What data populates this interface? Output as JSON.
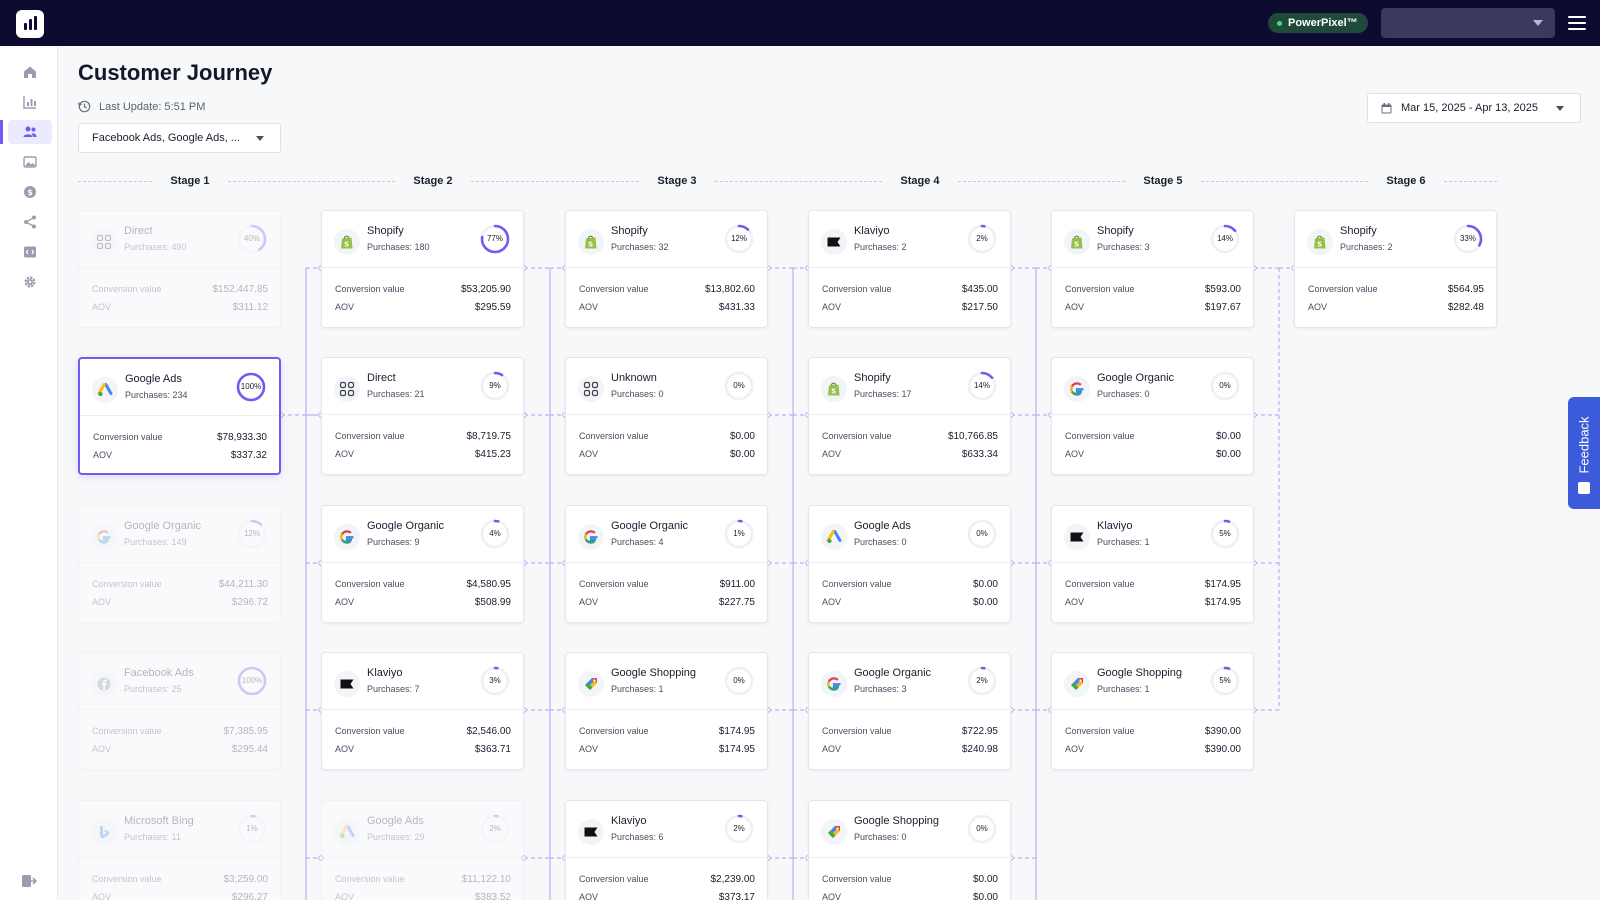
{
  "topbar": {
    "brand_badge": "PowerPixel™",
    "account_value": ""
  },
  "sidebar": {
    "items": [
      {
        "name": "home-icon",
        "active": false
      },
      {
        "name": "analytics-icon",
        "active": false
      },
      {
        "name": "customer-journey-icon",
        "active": true
      },
      {
        "name": "creatives-icon",
        "active": false
      },
      {
        "name": "revenue-icon",
        "active": false
      },
      {
        "name": "share-icon",
        "active": false
      },
      {
        "name": "code-icon",
        "active": false
      },
      {
        "name": "settings-icon",
        "active": false
      }
    ]
  },
  "header": {
    "title": "Customer Journey",
    "last_update": "Last Update: 5:51 PM",
    "source_filter": "Facebook Ads, Google Ads, ...",
    "date_range": "Mar 15, 2025 - Apr 13, 2025"
  },
  "labels": {
    "conversion_value": "Conversion value",
    "aov": "AOV"
  },
  "stages": [
    {
      "label": "Stage 1",
      "cards": [
        {
          "channel": "Direct",
          "icon": "direct-icon",
          "purchases": "Purchases: 490",
          "pct": 40,
          "pct_label": "40%",
          "conversion_value": "$152,447.85",
          "aov": "$311.12",
          "state": "dim"
        },
        {
          "channel": "Google Ads",
          "icon": "google-ads-icon",
          "purchases": "Purchases: 234",
          "pct": 100,
          "pct_label": "100%",
          "conversion_value": "$78,933.30",
          "aov": "$337.32",
          "state": "selected"
        },
        {
          "channel": "Google Organic",
          "icon": "google-icon",
          "purchases": "Purchases: 149",
          "pct": 12,
          "pct_label": "12%",
          "conversion_value": "$44,211.30",
          "aov": "$296.72",
          "state": "dim"
        },
        {
          "channel": "Facebook Ads",
          "icon": "facebook-icon",
          "purchases": "Purchases: 25",
          "pct": 100,
          "pct_label": "100%",
          "conversion_value": "$7,385.95",
          "aov": "$295.44",
          "state": "dim"
        },
        {
          "channel": "Microsoft Bing",
          "icon": "bing-icon",
          "purchases": "Purchases: 11",
          "pct": 1,
          "pct_label": "1%",
          "conversion_value": "$3,259.00",
          "aov": "$296.27",
          "state": "dim"
        }
      ]
    },
    {
      "label": "Stage 2",
      "cards": [
        {
          "channel": "Shopify",
          "icon": "shopify-icon",
          "purchases": "Purchases: 180",
          "pct": 77,
          "pct_label": "77%",
          "conversion_value": "$53,205.90",
          "aov": "$295.59",
          "state": "normal"
        },
        {
          "channel": "Direct",
          "icon": "direct-icon",
          "purchases": "Purchases: 21",
          "pct": 9,
          "pct_label": "9%",
          "conversion_value": "$8,719.75",
          "aov": "$415.23",
          "state": "normal"
        },
        {
          "channel": "Google Organic",
          "icon": "google-icon",
          "purchases": "Purchases: 9",
          "pct": 4,
          "pct_label": "4%",
          "conversion_value": "$4,580.95",
          "aov": "$508.99",
          "state": "normal"
        },
        {
          "channel": "Klaviyo",
          "icon": "klaviyo-icon",
          "purchases": "Purchases: 7",
          "pct": 3,
          "pct_label": "3%",
          "conversion_value": "$2,546.00",
          "aov": "$363.71",
          "state": "normal"
        },
        {
          "channel": "Google Ads",
          "icon": "google-ads-icon",
          "purchases": "Purchases: 29",
          "pct": 2,
          "pct_label": "2%",
          "conversion_value": "$11,122.10",
          "aov": "$383.52",
          "state": "dim"
        }
      ]
    },
    {
      "label": "Stage 3",
      "cards": [
        {
          "channel": "Shopify",
          "icon": "shopify-icon",
          "purchases": "Purchases: 32",
          "pct": 12,
          "pct_label": "12%",
          "conversion_value": "$13,802.60",
          "aov": "$431.33",
          "state": "normal"
        },
        {
          "channel": "Unknown",
          "icon": "direct-icon",
          "purchases": "Purchases: 0",
          "pct": 0,
          "pct_label": "0%",
          "conversion_value": "$0.00",
          "aov": "$0.00",
          "state": "normal"
        },
        {
          "channel": "Google Organic",
          "icon": "google-icon",
          "purchases": "Purchases: 4",
          "pct": 1,
          "pct_label": "1%",
          "conversion_value": "$911.00",
          "aov": "$227.75",
          "state": "normal"
        },
        {
          "channel": "Google Shopping",
          "icon": "google-shopping-icon",
          "purchases": "Purchases: 1",
          "pct": 0,
          "pct_label": "0%",
          "conversion_value": "$174.95",
          "aov": "$174.95",
          "state": "normal"
        },
        {
          "channel": "Klaviyo",
          "icon": "klaviyo-icon",
          "purchases": "Purchases: 6",
          "pct": 2,
          "pct_label": "2%",
          "conversion_value": "$2,239.00",
          "aov": "$373.17",
          "state": "normal"
        }
      ]
    },
    {
      "label": "Stage 4",
      "cards": [
        {
          "channel": "Klaviyo",
          "icon": "klaviyo-icon",
          "purchases": "Purchases: 2",
          "pct": 2,
          "pct_label": "2%",
          "conversion_value": "$435.00",
          "aov": "$217.50",
          "state": "normal"
        },
        {
          "channel": "Shopify",
          "icon": "shopify-icon",
          "purchases": "Purchases: 17",
          "pct": 14,
          "pct_label": "14%",
          "conversion_value": "$10,766.85",
          "aov": "$633.34",
          "state": "normal"
        },
        {
          "channel": "Google Ads",
          "icon": "google-ads-icon",
          "purchases": "Purchases: 0",
          "pct": 0,
          "pct_label": "0%",
          "conversion_value": "$0.00",
          "aov": "$0.00",
          "state": "normal"
        },
        {
          "channel": "Google Organic",
          "icon": "google-icon",
          "purchases": "Purchases: 3",
          "pct": 2,
          "pct_label": "2%",
          "conversion_value": "$722.95",
          "aov": "$240.98",
          "state": "normal"
        },
        {
          "channel": "Google Shopping",
          "icon": "google-shopping-icon",
          "purchases": "Purchases: 0",
          "pct": 0,
          "pct_label": "0%",
          "conversion_value": "$0.00",
          "aov": "$0.00",
          "state": "normal"
        }
      ]
    },
    {
      "label": "Stage 5",
      "cards": [
        {
          "channel": "Shopify",
          "icon": "shopify-icon",
          "purchases": "Purchases: 3",
          "pct": 14,
          "pct_label": "14%",
          "conversion_value": "$593.00",
          "aov": "$197.67",
          "state": "normal"
        },
        {
          "channel": "Google Organic",
          "icon": "google-icon",
          "purchases": "Purchases: 0",
          "pct": 0,
          "pct_label": "0%",
          "conversion_value": "$0.00",
          "aov": "$0.00",
          "state": "normal"
        },
        {
          "channel": "Klaviyo",
          "icon": "klaviyo-icon",
          "purchases": "Purchases: 1",
          "pct": 5,
          "pct_label": "5%",
          "conversion_value": "$174.95",
          "aov": "$174.95",
          "state": "normal"
        },
        {
          "channel": "Google Shopping",
          "icon": "google-shopping-icon",
          "purchases": "Purchases: 1",
          "pct": 5,
          "pct_label": "5%",
          "conversion_value": "$390.00",
          "aov": "$390.00",
          "state": "normal"
        }
      ]
    },
    {
      "label": "Stage 6",
      "cards": [
        {
          "channel": "Shopify",
          "icon": "shopify-icon",
          "purchases": "Purchases: 2",
          "pct": 33,
          "pct_label": "33%",
          "conversion_value": "$564.95",
          "aov": "$282.48",
          "state": "normal"
        }
      ]
    }
  ],
  "feedback": {
    "label": "Feedback"
  },
  "colors": {
    "accent": "#6f5cf0",
    "topbar": "#0e0b31",
    "feedback": "#3b5bdb",
    "shopify": "#95bf47",
    "badge_bg": "#1f4a3a"
  }
}
